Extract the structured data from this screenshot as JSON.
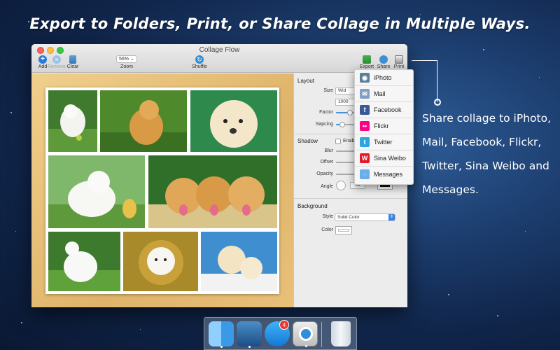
{
  "headline": "Export to Folders, Print, or Share Collage in Multiple Ways.",
  "side_caption": [
    "Share collage to iPhoto,",
    "Mail, Facebook, Flickr,",
    "Twitter, Sina Weibo and",
    "Messages."
  ],
  "window": {
    "title": "Collage Flow",
    "toolbar": {
      "add": "Add",
      "remove": "Remove",
      "clear": "Clear",
      "zoom_label": "Zoom",
      "zoom_value": "56%",
      "shuffle": "Shuffle",
      "export": "Export",
      "share": "Share",
      "print": "Print"
    }
  },
  "inspector": {
    "layout_title": "Layout",
    "size_label": "Size",
    "size_value": "Wid",
    "size_number": "1000",
    "factor_label": "Factor",
    "factor_level": 0.75,
    "spacing_label": "Sapcing",
    "spacing_level": 0.35,
    "shadow_title": "Shadow",
    "shadow_enable": "Enab",
    "blur_label": "Blur",
    "offset_label": "Offset",
    "opacity_label": "Opacity",
    "angle_label": "Angle",
    "angle_value": "53",
    "background_title": "Background",
    "style_label": "Style",
    "style_value": "Solid Color",
    "color_label": "Color"
  },
  "share_menu": [
    {
      "label": "iPhoto",
      "icon": "iphoto-icon",
      "color": "#5a7f99"
    },
    {
      "label": "Mail",
      "icon": "mail-icon",
      "color": "#7fa0c0"
    },
    {
      "label": "Facebook",
      "icon": "facebook-icon",
      "color": "#3b5998"
    },
    {
      "label": "Flickr",
      "icon": "flickr-icon",
      "color": "#ff0084"
    },
    {
      "label": "Twitter",
      "icon": "twitter-icon",
      "color": "#2fa5e0"
    },
    {
      "label": "Sina Weibo",
      "icon": "weibo-icon",
      "color": "#e6162d"
    },
    {
      "label": "Messages",
      "icon": "messages-icon",
      "color": "#6aaee8"
    }
  ],
  "dock": {
    "items": [
      "finder-icon",
      "xcode-icon",
      "app-store-icon",
      "collage-flow-icon",
      "trash-icon"
    ],
    "app_store_badge": "4"
  },
  "colors": {
    "accent": "#2a7bd8",
    "wood": "#dfb46a"
  }
}
